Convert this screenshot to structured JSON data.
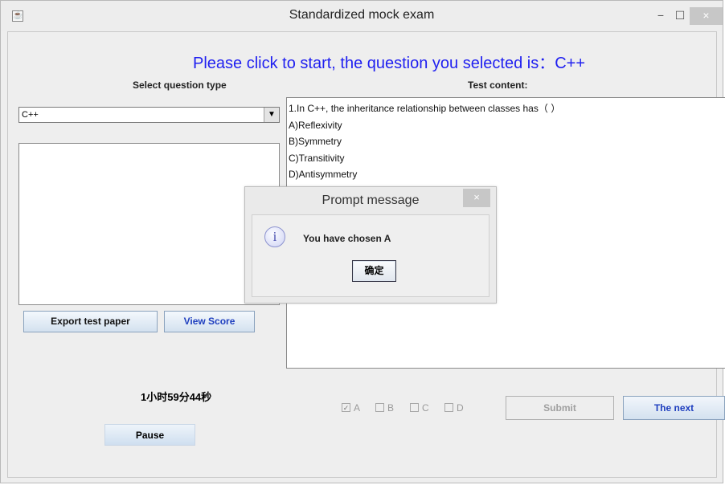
{
  "window": {
    "title": "Standardized mock exam",
    "app_icon": "java-cup-icon",
    "minimize": "−",
    "maximize": "☐",
    "close": "×"
  },
  "header": {
    "headline": "Please click to start, the question you selected is：C++"
  },
  "left": {
    "section_label": "Select question type",
    "question_type_value": "C++",
    "export_button": "Export test paper",
    "view_score_button": "View Score",
    "timer": "1小时59分44秒",
    "pause_button": "Pause"
  },
  "right": {
    "section_label": "Test content:",
    "content_lines": [
      "1.In C++, the inheritance relationship between classes has（  ）",
      "A)Reflexivity",
      "B)Symmetry",
      "C)Transitivity",
      "D)Antisymmetry"
    ]
  },
  "answers": {
    "options": [
      {
        "label": "A",
        "checked": true
      },
      {
        "label": "B",
        "checked": false
      },
      {
        "label": "C",
        "checked": false
      },
      {
        "label": "D",
        "checked": false
      }
    ],
    "submit_button": "Submit",
    "next_button": "The next"
  },
  "dialog": {
    "title": "Prompt message",
    "close": "×",
    "icon": "info-icon",
    "message": "You have chosen A",
    "ok_button": "确定"
  },
  "colors": {
    "headline": "#1f1ff0",
    "accent_button_text": "#1f3fbf",
    "close_button": "#c7c7c7"
  }
}
